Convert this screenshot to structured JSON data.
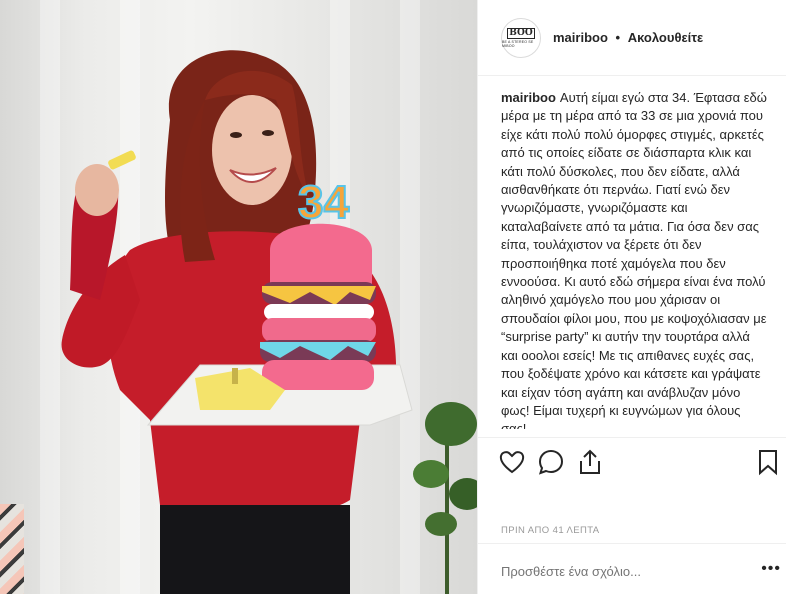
{
  "post": {
    "username": "mairiboo",
    "follow_label": "Ακολουθείτε",
    "separator": "•",
    "avatar_text": {
      "big": "BOO",
      "small": "BE A STEREO SE MIBOO"
    },
    "caption_user": "mairiboo",
    "caption_text": "Αυτή είμαι εγώ στα 34. Έφτασα εδώ μέρα με τη μέρα από τα 33 σε μια χρονιά που είχε κάτι πολύ πολύ όμορφες στιγμές, αρκετές από τις οποίες είδατε σε διάσπαρτα κλικ και κάτι πολύ δύσκολες, που δεν είδατε, αλλά αισθανθήκατε ότι περνάω. Γιατί ενώ δεν γνωριζόμαστε, γνωριζόμαστε και καταλαβαίνετε από τα μάτια. Για όσα δεν σας είπα, τουλάχιστον να ξέρετε ότι δεν προσποιήθηκα ποτέ χαμόγελα που δεν εννοούσα. Κι αυτό εδώ σήμερα είναι ένα πολύ αληθινό χαμόγελο που μου χάρισαν οι σπουδαίοι φίλοι μου, που με κοψοχόλιασαν με “surprise party” κι αυτήν την τουρτάρα αλλά και οοολοι εσείς! Με τις απιθανες ευχές σας, που ξοδέψατε χρόνο και κάτσετε και γράψατε και είχαν τόση αγάπη και ανάβλυζαν μόνο φως! Είμαι τυχερή κι ευγνώμων για όλους σας!",
    "timestamp": "ΠΡΙΝ ΑΠΟ 41 ΛΕΠΤΑ",
    "comment_placeholder": "Προσθέστε ένα σχόλιο...",
    "more_label": "•••",
    "candle_text": "34",
    "icons": [
      "heart-icon",
      "comment-icon",
      "share-icon",
      "bookmark-icon"
    ]
  }
}
